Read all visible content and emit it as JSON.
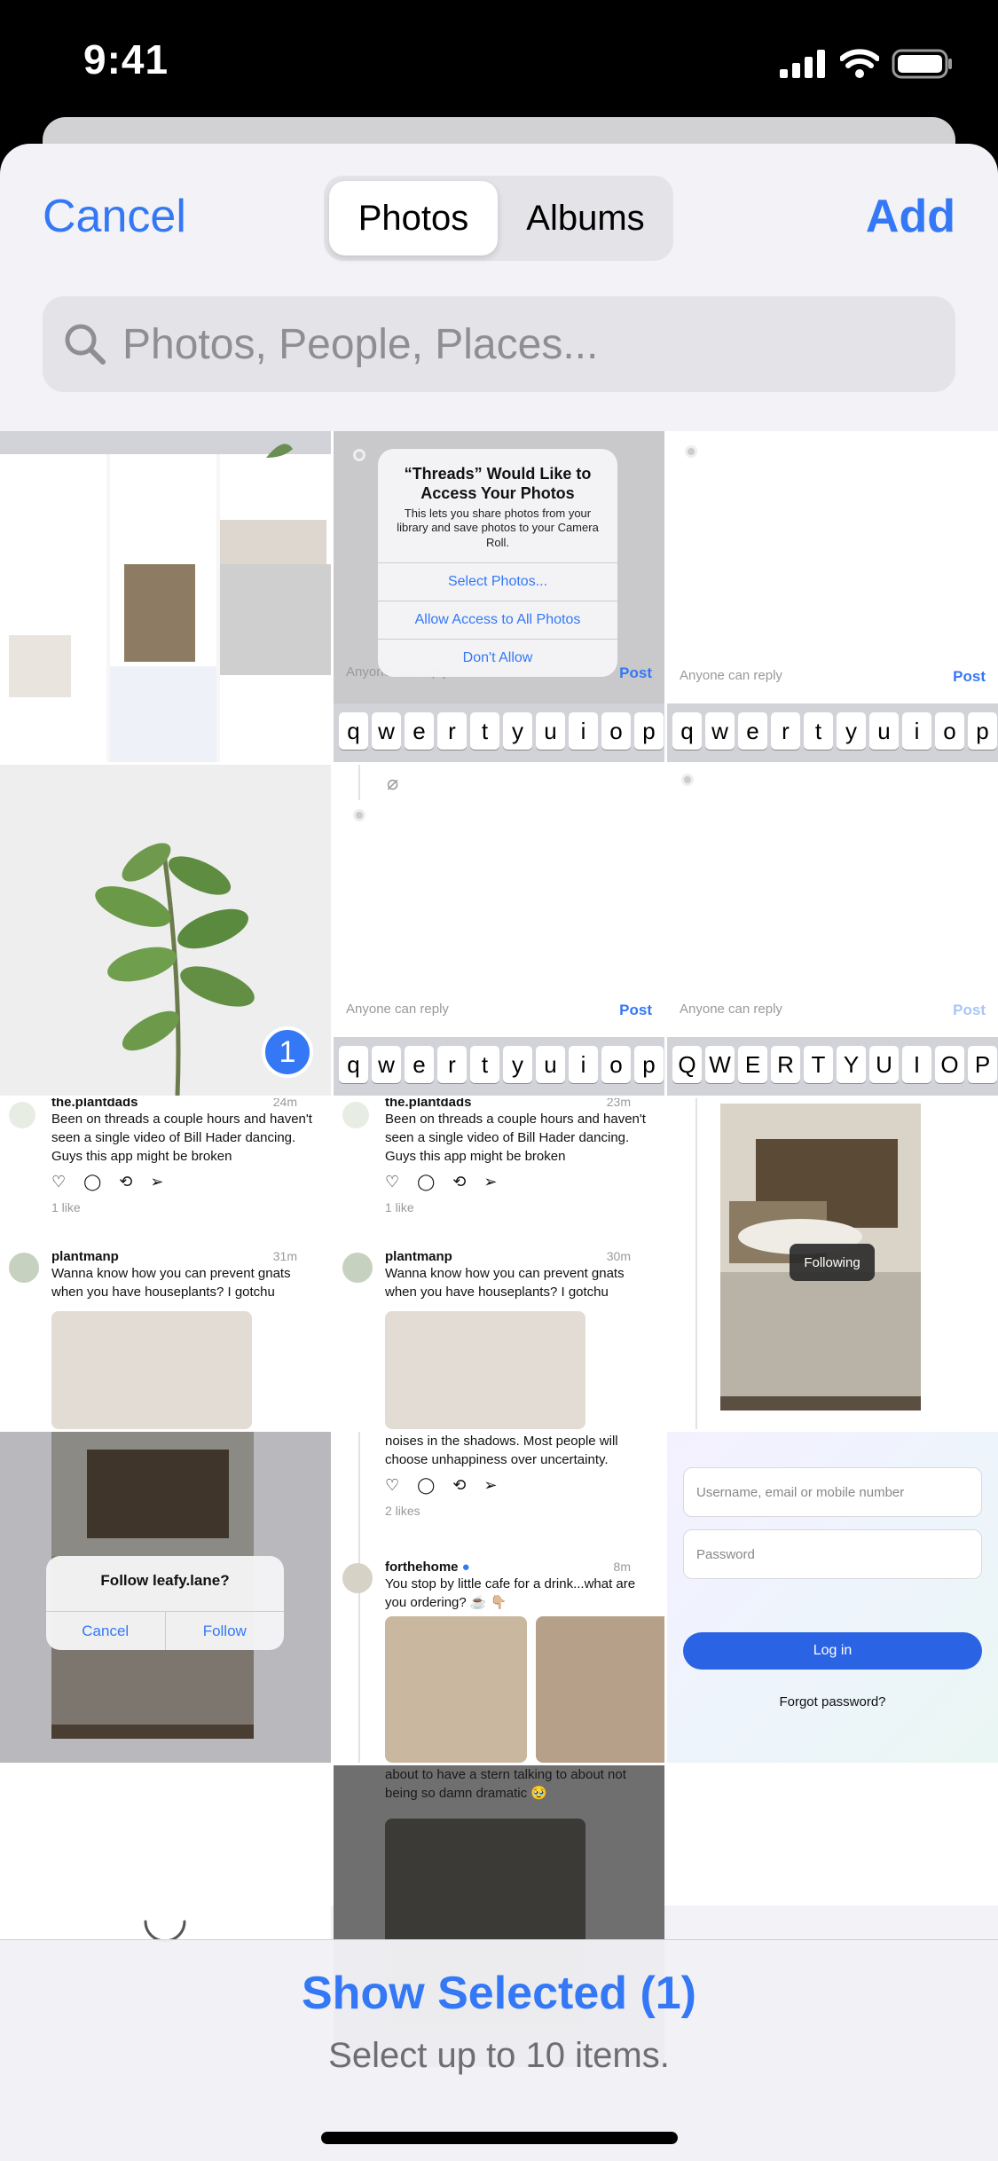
{
  "status_bar": {
    "time": "9:41"
  },
  "nav": {
    "cancel": "Cancel",
    "add": "Add",
    "tabs": [
      "Photos",
      "Albums"
    ],
    "active_tab": "Photos"
  },
  "search": {
    "placeholder": "Photos, People, Places..."
  },
  "tiles": {
    "t1": {
      "reply": "Anyone can reply",
      "post": "Post",
      "alert_title": "“Threads” Would Like to Access Your Photos",
      "alert_message": "This lets you share photos from your library and save photos to your Camera Roll.",
      "alert_buttons": [
        "Select Photos...",
        "Allow Access to All Photos",
        "Don't Allow"
      ],
      "keys": [
        "q",
        "w",
        "e",
        "r",
        "t",
        "y",
        "u",
        "i",
        "o",
        "p"
      ]
    },
    "t2": {
      "reply": "Anyone can reply",
      "post": "Post",
      "keys": [
        "q",
        "w",
        "e",
        "r",
        "t",
        "y",
        "u",
        "i",
        "o",
        "p"
      ]
    },
    "t4": {
      "selection_number": "1"
    },
    "t5": {
      "reply": "Anyone can reply",
      "post": "Post",
      "keys": [
        "q",
        "w",
        "e",
        "r",
        "t",
        "y",
        "u",
        "i",
        "o",
        "p"
      ]
    },
    "t6": {
      "reply": "Anyone can reply",
      "post": "Post",
      "keys": [
        "Q",
        "W",
        "E",
        "R",
        "T",
        "Y",
        "U",
        "I",
        "O",
        "P"
      ]
    },
    "t7": {
      "handle1": "the.plantdads",
      "time1": "24m",
      "text1": "Been on threads a couple hours and haven't seen a single video of Bill Hader dancing. Guys this app might be broken",
      "likes1": "1 like",
      "handle2": "plantmanp",
      "time2": "31m",
      "text2": "Wanna know how you can prevent gnats when you have houseplants? I gotchu"
    },
    "t8": {
      "handle1": "the.plantdads",
      "time1": "23m",
      "text1": "Been on threads a couple hours and haven't seen a single video of Bill Hader dancing. Guys this app might be broken",
      "likes1": "1 like",
      "handle2": "plantmanp",
      "time2": "30m",
      "text2": "Wanna know how you can prevent gnats when you have houseplants? I gotchu"
    },
    "t9": {
      "pill": "Following"
    },
    "t10": {
      "title": "Follow leafy.lane?",
      "cancel": "Cancel",
      "follow": "Follow"
    },
    "t11": {
      "text1": "noises in the shadows. Most people will choose unhappiness over uncertainty.",
      "likes": "2 likes",
      "handle": "forthehome",
      "time": "8m",
      "text2": "You stop by little cafe for a drink...what are you ordering? ☕ 👇🏼"
    },
    "t12": {
      "username_placeholder": "Username, email or mobile number",
      "password_placeholder": "Password",
      "login": "Log in",
      "forgot": "Forgot password?"
    },
    "t14": {
      "text": "about to have a stern talking to about not being so damn dramatic 🥹"
    }
  },
  "bottom": {
    "show_selected": "Show Selected (1)",
    "limit": "Select up to 10 items."
  },
  "colors": {
    "accent": "#3478f6",
    "sheet_bg": "#f2f2f7"
  }
}
